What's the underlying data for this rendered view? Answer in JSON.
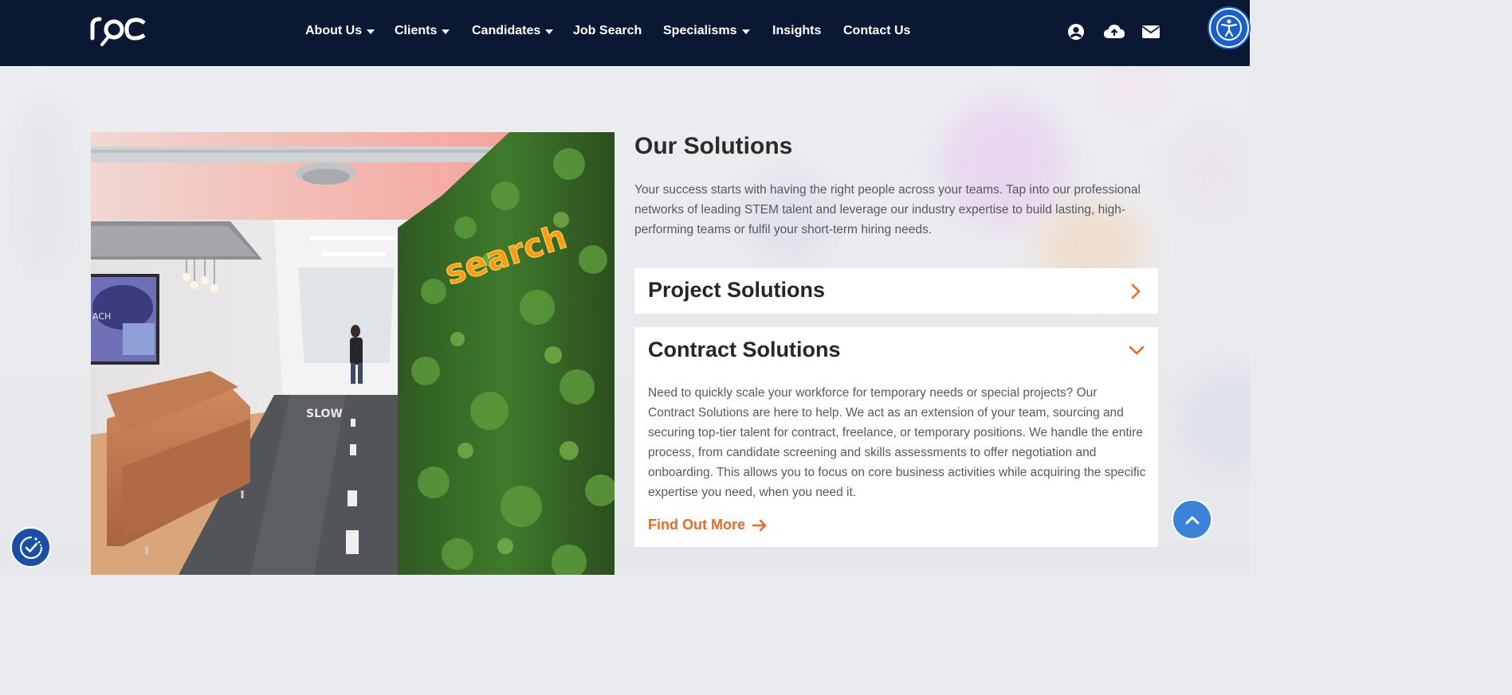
{
  "brand": {
    "logo_text": "roc"
  },
  "nav": {
    "items": [
      {
        "label": "About Us",
        "has_dropdown": true
      },
      {
        "label": "Clients",
        "has_dropdown": true
      },
      {
        "label": "Candidates",
        "has_dropdown": true
      },
      {
        "label": "Job Search",
        "has_dropdown": false
      },
      {
        "label": "Specialisms",
        "has_dropdown": true
      },
      {
        "label": "Insights",
        "has_dropdown": false
      },
      {
        "label": "Contact Us",
        "has_dropdown": false
      }
    ],
    "icons": [
      "user-icon",
      "cloud-upload-icon",
      "envelope-icon"
    ]
  },
  "accessibility": {
    "icon": "accessibility-icon"
  },
  "hero_image": {
    "sign_text": "search",
    "road_text": "SLOW"
  },
  "solutions": {
    "title": "Our Solutions",
    "intro": "Your success starts with having the right people across your teams. Tap into our professional networks of leading STEM talent and leverage our industry expertise to build lasting, high-performing teams or fulfil your short-term hiring needs.",
    "panels": [
      {
        "title": "Project Solutions",
        "expanded": false
      },
      {
        "title": "Contract Solutions",
        "expanded": true,
        "body": "Need to quickly scale your workforce for temporary needs or special projects? Our Contract Solutions are here to help. We act as an extension of your team, sourcing and securing top-tier talent for contract, freelance, or temporary positions. We handle the entire process, from candidate screening and skills assessments to offer negotiation and onboarding. This allows you to focus on core business activities while acquiring the specific expertise you need, when you need it.",
        "cta": "Find Out More"
      }
    ]
  },
  "colors": {
    "header_bg": "#0b1833",
    "accent": "#ee6a22",
    "scroll_btn": "#3b82d9"
  }
}
